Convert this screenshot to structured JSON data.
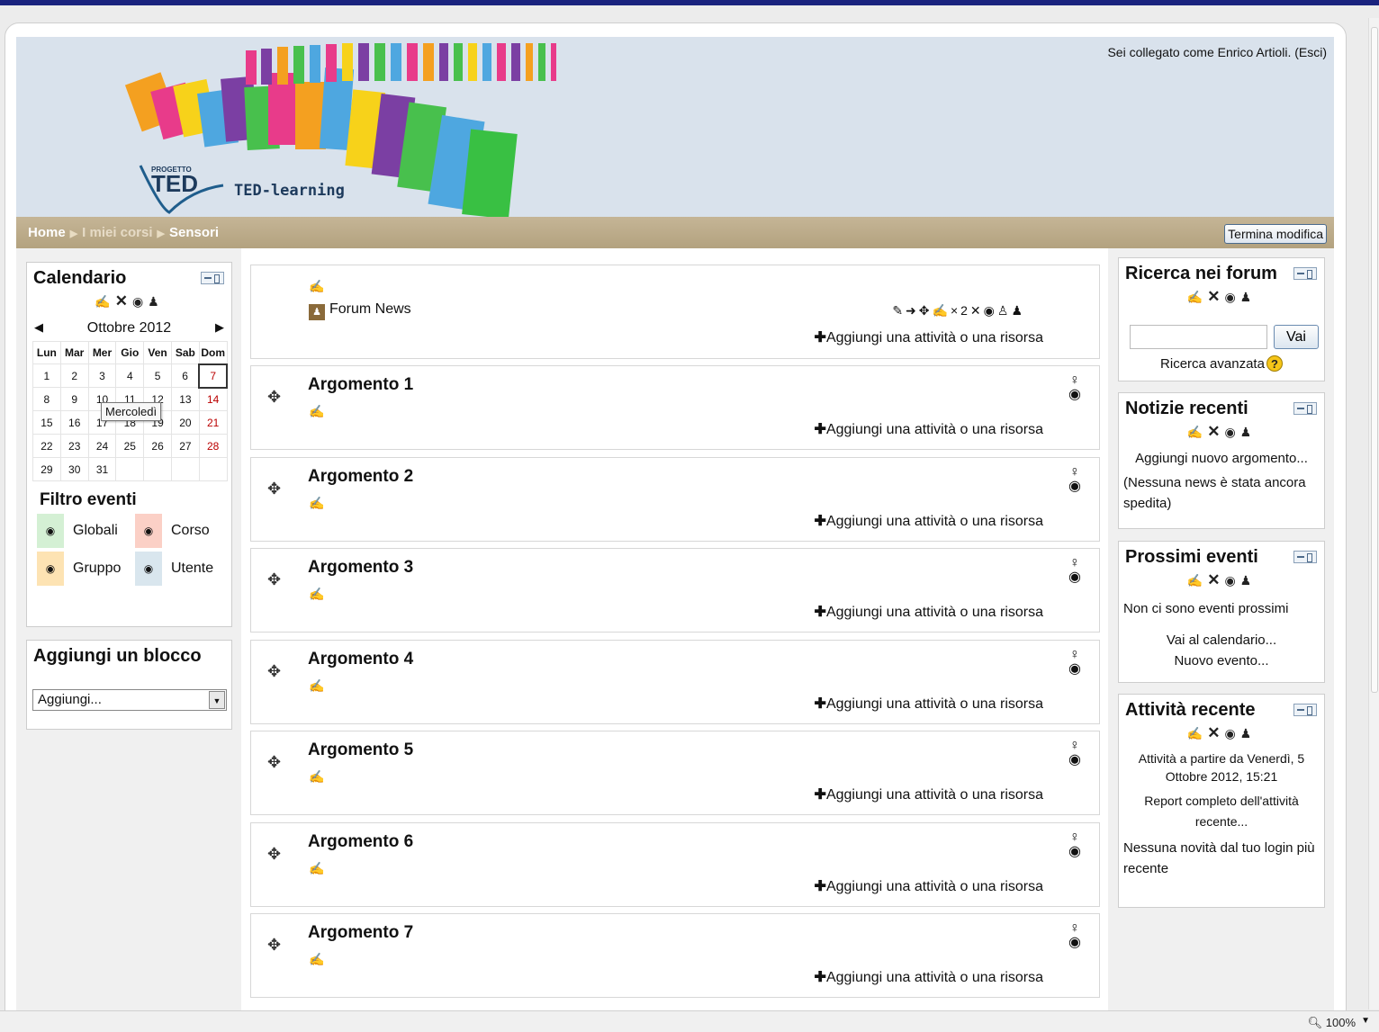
{
  "header": {
    "login_text": "Sei collegato come Enrico Artioli. (Esci)",
    "logo_small": "PROGETTO",
    "logo_main": "TED",
    "logo_sub": "TED-learning"
  },
  "breadcrumb": {
    "home": "Home",
    "courses": "I miei corsi",
    "current": "Sensori"
  },
  "edit_button": "Termina modifica",
  "calendar": {
    "title": "Calendario",
    "month": "Ottobre 2012",
    "days": [
      "Lun",
      "Mar",
      "Mer",
      "Gio",
      "Ven",
      "Sab",
      "Dom"
    ],
    "weeks": [
      [
        "1",
        "2",
        "3",
        "4",
        "5",
        "6",
        "7"
      ],
      [
        "8",
        "9",
        "10",
        "11",
        "12",
        "13",
        "14"
      ],
      [
        "15",
        "16",
        "17",
        "18",
        "19",
        "20",
        "21"
      ],
      [
        "22",
        "23",
        "24",
        "25",
        "26",
        "27",
        "28"
      ],
      [
        "29",
        "30",
        "31",
        "",
        "",
        "",
        ""
      ]
    ],
    "tooltip": "Mercoledì",
    "filter_title": "Filtro eventi",
    "filters": [
      {
        "label": "Globali",
        "color": "#d4f0d4"
      },
      {
        "label": "Corso",
        "color": "#fbd0c6"
      },
      {
        "label": "Gruppo",
        "color": "#fde3b3"
      },
      {
        "label": "Utente",
        "color": "#d9e6ee"
      }
    ]
  },
  "add_block": {
    "title": "Aggiungi un blocco",
    "select_value": "Aggiungi..."
  },
  "sections": {
    "forum_news": "Forum News",
    "add_activity": "Aggiungi una attività o una risorsa",
    "topics": [
      "Argomento 1",
      "Argomento 2",
      "Argomento 3",
      "Argomento 4",
      "Argomento 5",
      "Argomento 6",
      "Argomento 7"
    ]
  },
  "forum_search": {
    "title": "Ricerca nei forum",
    "button": "Vai",
    "advanced": "Ricerca avanzata"
  },
  "news": {
    "title": "Notizie recenti",
    "add": "Aggiungi nuovo argomento...",
    "none": "(Nessuna news è stata ancora spedita)"
  },
  "events": {
    "title": "Prossimi eventi",
    "none": "Non ci sono eventi prossimi",
    "goto": "Vai al calendario...",
    "new": "Nuovo evento..."
  },
  "recent_activity": {
    "title": "Attività recente",
    "since": "Attività a partire da Venerdì, 5 Ottobre 2012, 15:21",
    "report": "Report completo dell'attività recente...",
    "none": "Nessuna novità dal tuo login più recente"
  },
  "statusbar": {
    "zoom": "100%"
  }
}
